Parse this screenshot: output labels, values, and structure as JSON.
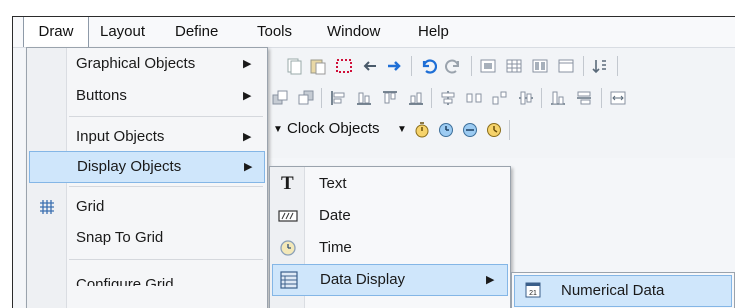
{
  "menubar": {
    "items": [
      "Draw",
      "Layout",
      "Define",
      "Tools",
      "Window",
      "Help"
    ]
  },
  "toolbar": {
    "clock_objects_label": "Clock Objects"
  },
  "draw_menu": {
    "items": [
      {
        "label": "Graphical Objects",
        "has_submenu": true
      },
      {
        "label": "Buttons",
        "has_submenu": true
      },
      {
        "label": "Input Objects",
        "has_submenu": true
      },
      {
        "label": "Display Objects",
        "has_submenu": true,
        "highlighted": true
      },
      {
        "label": "Grid",
        "icon": "grid-icon"
      },
      {
        "label": "Snap To Grid"
      },
      {
        "label": "Configure Grid"
      }
    ]
  },
  "display_objects_menu": {
    "items": [
      {
        "label": "Text",
        "icon": "text-t-icon"
      },
      {
        "label": "Date",
        "icon": "date-icon"
      },
      {
        "label": "Time",
        "icon": "clock-icon"
      },
      {
        "label": "Data Display",
        "icon": "data-display-icon",
        "has_submenu": true,
        "highlighted": true
      }
    ]
  },
  "data_display_menu": {
    "items": [
      {
        "label": "Numerical Data",
        "icon": "numerical-data-icon",
        "highlighted": true
      }
    ]
  },
  "colors": {
    "highlight_bg": "#cfe6fb",
    "highlight_border": "#84b6e6",
    "accent_blue": "#1f6fd6",
    "arrow_red": "#d0103a"
  }
}
